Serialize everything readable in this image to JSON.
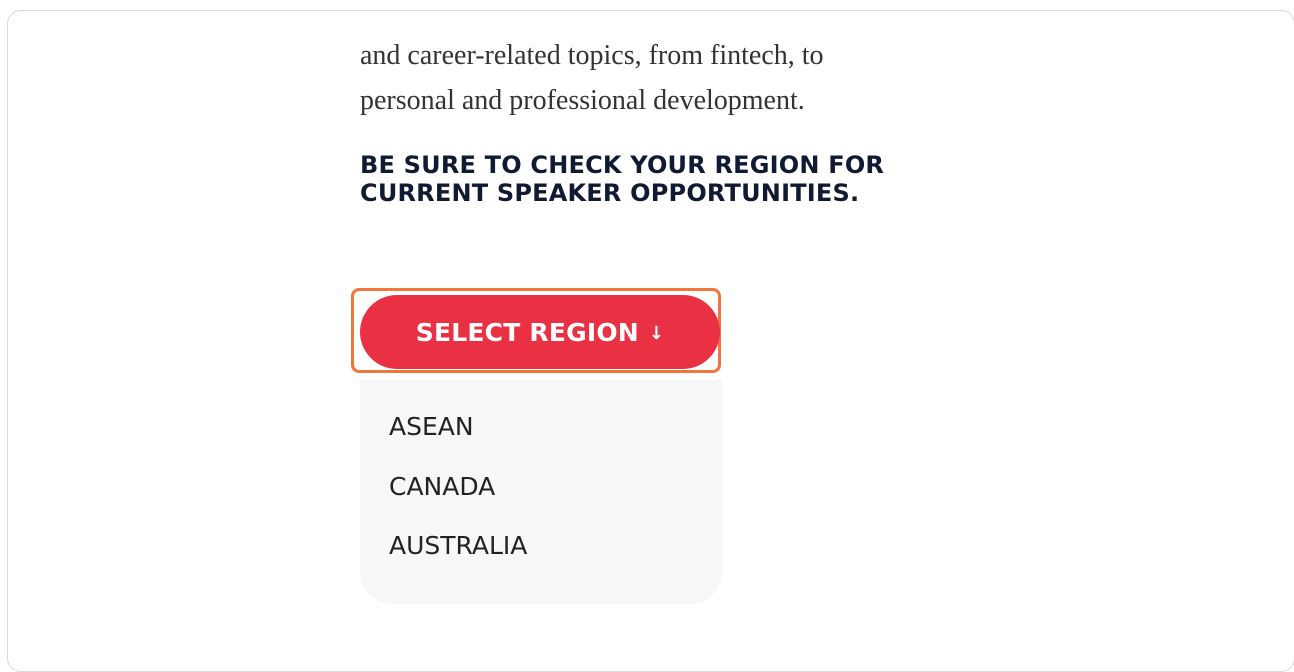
{
  "article": {
    "paragraph_lines": [
      "and career-related topics, from fintech, to",
      "personal and professional development."
    ],
    "notice_lines": [
      "BE SURE TO CHECK YOUR REGION FOR",
      "CURRENT SPEAKER OPPORTUNITIES."
    ]
  },
  "region_select": {
    "button_label": "SELECT REGION",
    "arrow_icon": "arrow-down-icon",
    "arrow_glyph": "↓",
    "options": [
      "ASEAN",
      "CANADA",
      "AUSTRALIA"
    ]
  },
  "colors": {
    "button": "#ea3144",
    "highlight": "#f2763a",
    "dropdown_bg": "#f7f7f7",
    "heading": "#111a33"
  }
}
